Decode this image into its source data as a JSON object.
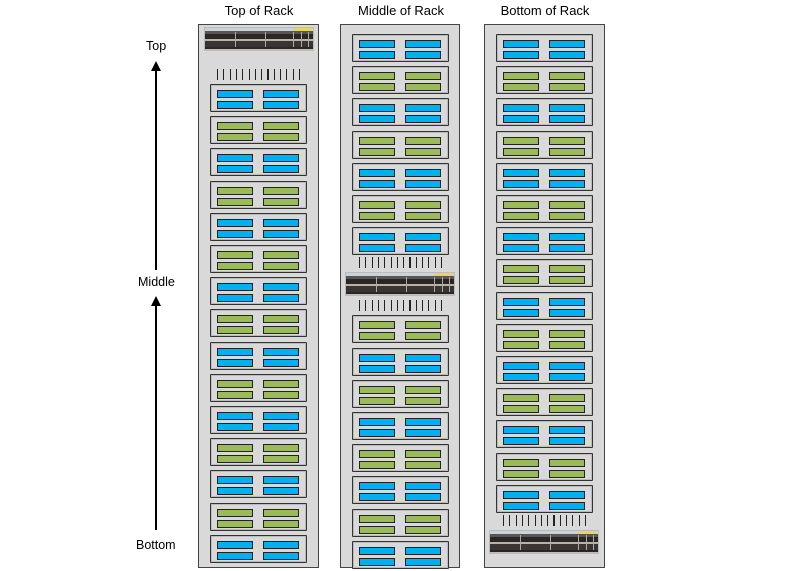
{
  "axis": {
    "labels": {
      "top": "Top",
      "middle": "Middle",
      "bottom": "Bottom"
    },
    "arrows": [
      {
        "from": "Middle",
        "to": "Top"
      },
      {
        "from": "Bottom",
        "to": "Middle"
      }
    ]
  },
  "colors": {
    "drive_blue": "#00b0f0",
    "drive_green": "#9bbb59",
    "rack_fill": "#d9d9d9"
  },
  "racks": [
    {
      "title": "Top of Rack",
      "units": [
        "switch",
        "cables",
        "blue",
        "green",
        "blue",
        "green",
        "blue",
        "green",
        "blue",
        "green",
        "blue",
        "green",
        "blue",
        "green",
        "blue",
        "green",
        "blue"
      ]
    },
    {
      "title": "Middle of Rack",
      "units": [
        "blue",
        "green",
        "blue",
        "green",
        "blue",
        "green",
        "blue",
        "cables",
        "switch",
        "cables",
        "green",
        "blue",
        "green",
        "blue",
        "green",
        "blue",
        "green",
        "blue"
      ]
    },
    {
      "title": "Bottom of Rack",
      "units": [
        "blue",
        "green",
        "blue",
        "green",
        "blue",
        "green",
        "blue",
        "green",
        "blue",
        "green",
        "blue",
        "green",
        "blue",
        "green",
        "blue",
        "cables",
        "switch"
      ]
    }
  ]
}
